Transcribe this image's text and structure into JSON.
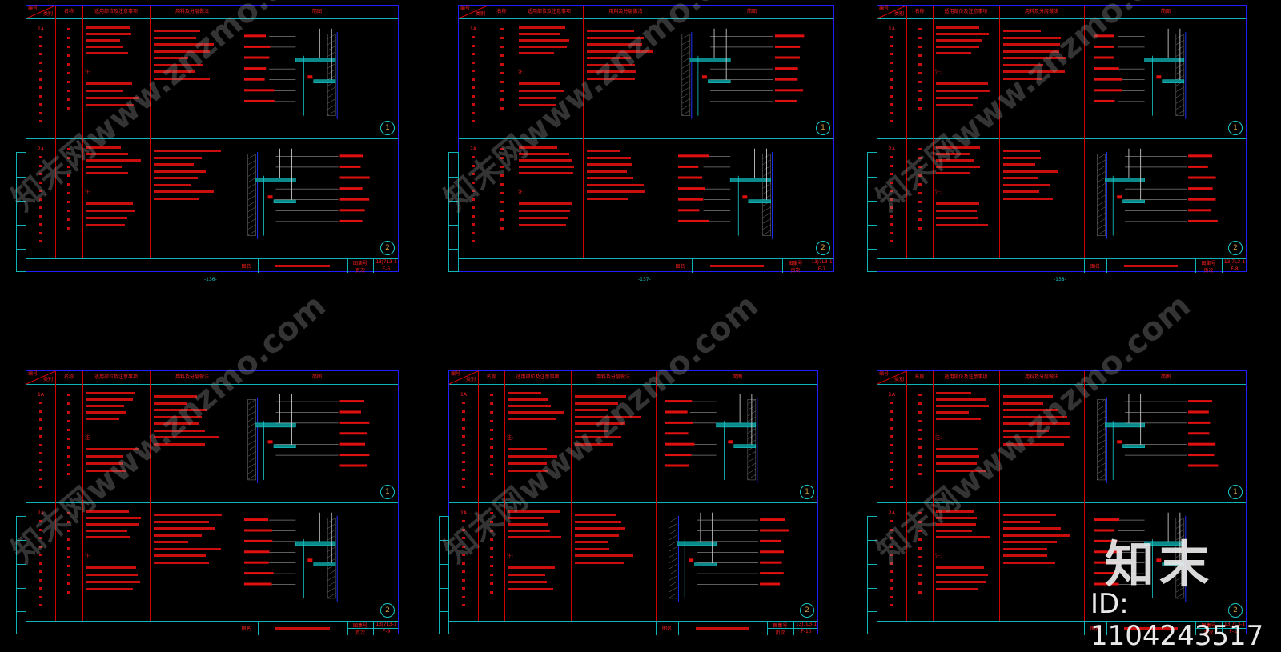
{
  "colors": {
    "background": "#000000",
    "frame": "#2020ff",
    "grid": "#0fb5b5",
    "lines": "#d00000",
    "text": "#ff2020"
  },
  "headers": {
    "code_top": "编号",
    "code_bottom": "类别",
    "name": "名称",
    "usage": "适用部位及注意事项",
    "materials": "用料及分层做法",
    "sketch": "简图"
  },
  "titleblock": {
    "drawing_name_label": "图名",
    "atlas_label": "图集号",
    "page_label": "页次"
  },
  "sheets": [
    {
      "row1_code": "1A",
      "row2_code": "2A",
      "note_label": "注:",
      "atlas_no": "13J7L3-1",
      "page": "F-6",
      "page_number": "-136-",
      "detail1": "1",
      "detail2": "2"
    },
    {
      "row1_code": "1A",
      "row2_code": "2A",
      "note_label": "注:",
      "atlas_no": "13J7L3-1",
      "page": "F-7",
      "page_number": "-137-",
      "detail1": "1",
      "detail2": "2"
    },
    {
      "row1_code": "1A",
      "row2_code": "2A",
      "note_label": "注:",
      "atlas_no": "13J7L3-1",
      "page": "F-8",
      "page_number": "-138-",
      "detail1": "1",
      "detail2": "2"
    },
    {
      "row1_code": "1A",
      "row2_code": "2A",
      "note_label": "注:",
      "atlas_no": "13J7L3-1",
      "page": "F-9",
      "page_number": "",
      "detail1": "1",
      "detail2": "2"
    },
    {
      "row1_code": "1A",
      "row2_code": "2A",
      "note_label": "注:",
      "atlas_no": "13J7L3-1",
      "page": "F-10",
      "page_number": "",
      "detail1": "1",
      "detail2": "2"
    },
    {
      "row1_code": "1A",
      "row2_code": "2A",
      "note_label": "注:",
      "atlas_no": "13J7L3-1",
      "page": "F-11",
      "page_number": "",
      "detail1": "1",
      "detail2": "2"
    }
  ],
  "watermark": {
    "text": "知末网www.znzmo.com",
    "brand": "知末",
    "id": "ID: 1104243517"
  }
}
